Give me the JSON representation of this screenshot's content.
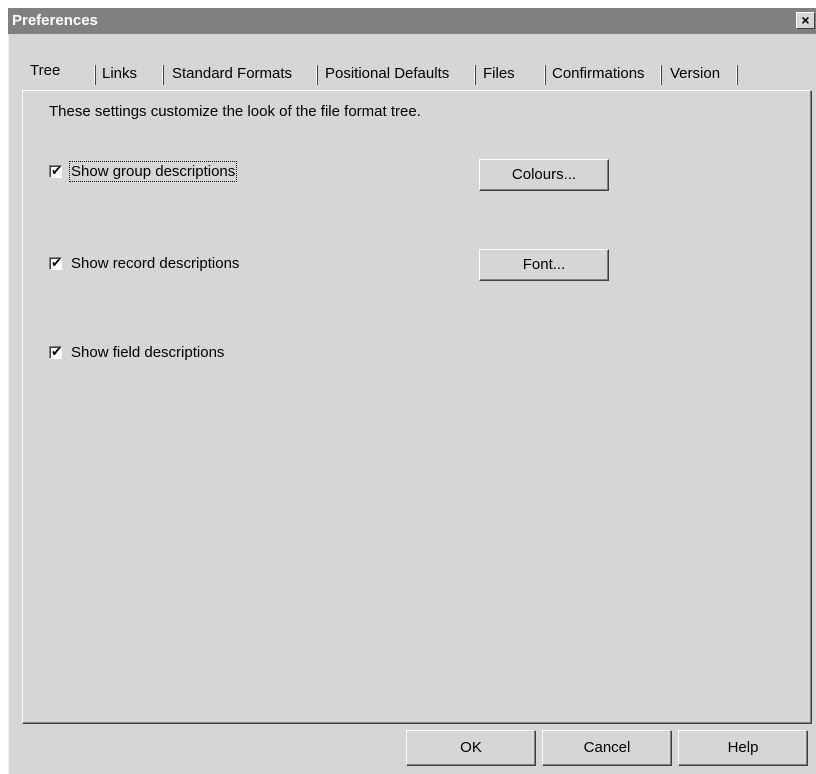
{
  "window": {
    "title": "Preferences",
    "close_label": "×"
  },
  "tabs": [
    {
      "label": "Tree",
      "active": true
    },
    {
      "label": "Links"
    },
    {
      "label": "Standard Formats"
    },
    {
      "label": "Positional Defaults"
    },
    {
      "label": "Files"
    },
    {
      "label": "Confirmations"
    },
    {
      "label": "Version"
    }
  ],
  "tree_panel": {
    "intro": "These settings customize the look of the file format tree.",
    "options": [
      {
        "label": "Show group descriptions",
        "checked": true,
        "check_glyph": "✔"
      },
      {
        "label": "Show record descriptions",
        "checked": true,
        "check_glyph": "✔"
      },
      {
        "label": "Show field descriptions",
        "checked": true,
        "check_glyph": "✔"
      }
    ],
    "colours_button": "Colours...",
    "font_button": "Font..."
  },
  "footer": {
    "ok": "OK",
    "cancel": "Cancel",
    "help": "Help"
  }
}
